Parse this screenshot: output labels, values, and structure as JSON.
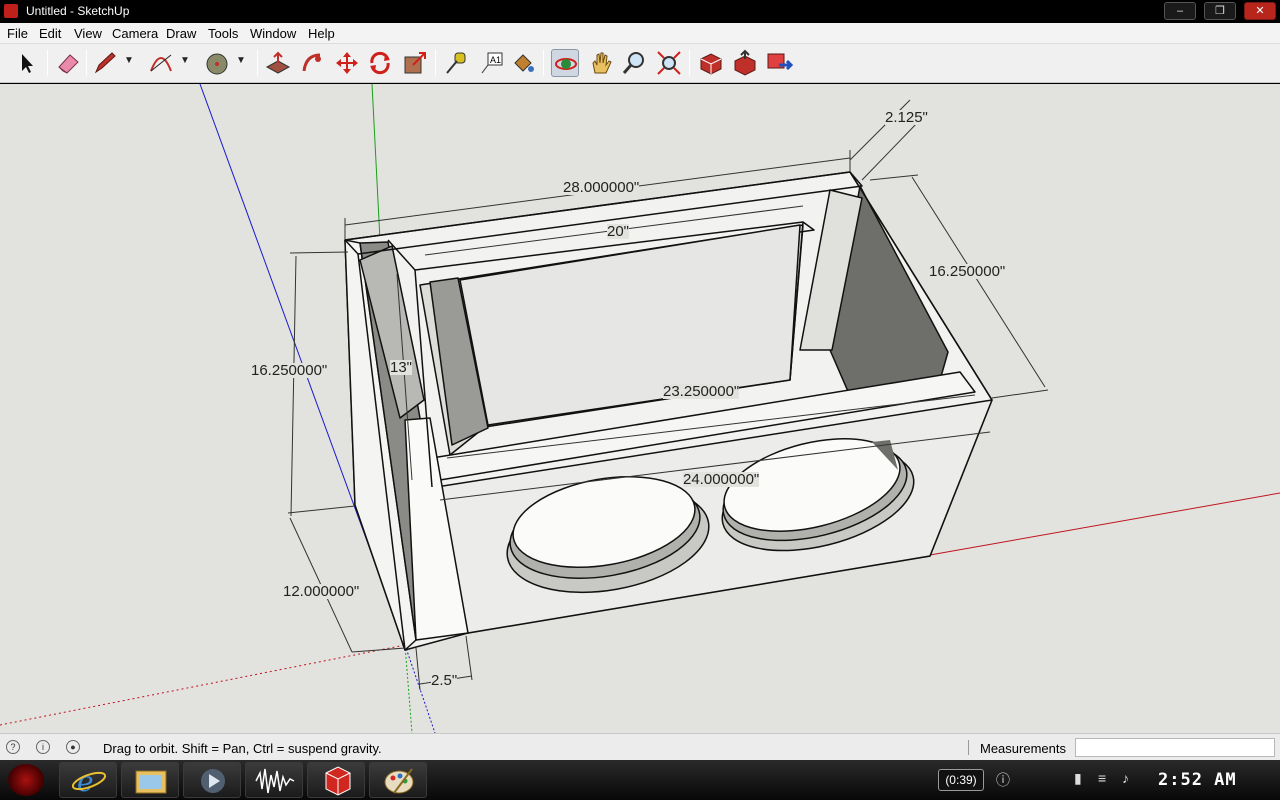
{
  "window": {
    "title": "Untitled - SketchUp"
  },
  "menubar": {
    "items": [
      "File",
      "Edit",
      "View",
      "Camera",
      "Draw",
      "Tools",
      "Window",
      "Help"
    ]
  },
  "toolbar": {
    "tools": [
      "select-icon",
      "eraser-icon",
      "pencil-icon",
      "arc-icon",
      "circle-icon",
      "push-pull-icon",
      "follow-me-icon",
      "move-icon",
      "rotate-icon",
      "scale-icon",
      "tape-measure-icon",
      "text-icon",
      "paint-bucket-icon",
      "orbit-icon",
      "pan-icon",
      "zoom-icon",
      "zoom-extents-icon",
      "get-models-icon",
      "share-model-icon",
      "components-icon"
    ],
    "active_tool": "orbit-icon"
  },
  "viewport": {
    "dimensions": [
      "28.000000\"",
      "2.125\"",
      "20\"",
      "16.250000\"",
      "16.250000\"",
      "13\"",
      "23.250000\"",
      "24.000000\"",
      "12.000000\"",
      "2.5\""
    ]
  },
  "statusbar": {
    "hint": "Drag to orbit. Shift = Pan, Ctrl = suspend gravity.",
    "measurements_label": "Measurements",
    "measurements_value": ""
  },
  "taskbar": {
    "apps": [
      "internet-explorer-icon",
      "file-explorer-icon",
      "media-player-icon",
      "audio-editor-icon",
      "sketchup-icon",
      "paint-icon"
    ],
    "battery": "(0:39)",
    "clock": "2:52 AM"
  },
  "colors": {
    "viewport_bg": "#e2e2df",
    "axis_red": "#c0141c",
    "axis_green": "#1aa01a",
    "axis_blue": "#1a1acc"
  }
}
